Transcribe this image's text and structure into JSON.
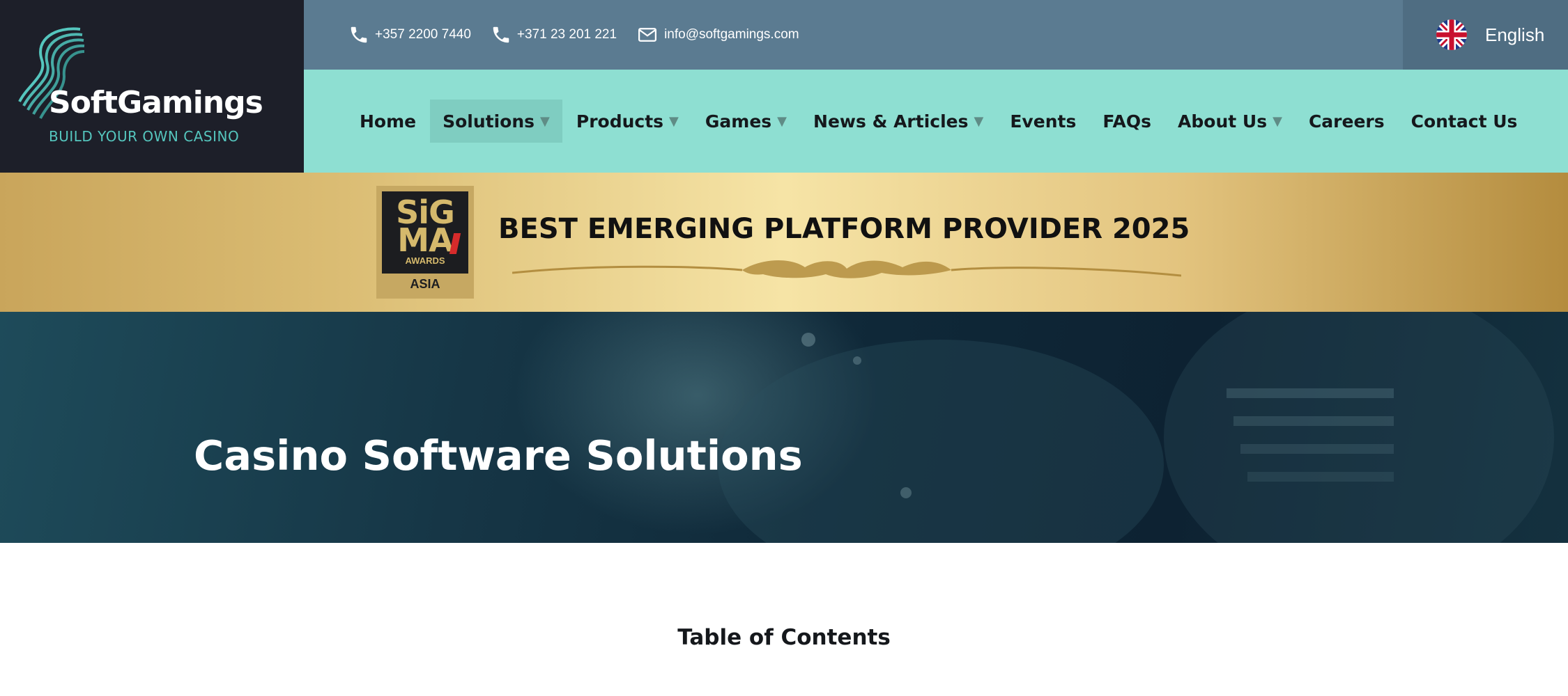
{
  "brand": {
    "name": "SoftGamings",
    "tagline": "BUILD YOUR OWN CASINO"
  },
  "contacts": [
    {
      "icon": "phone-icon",
      "text": "+357 2200 7440"
    },
    {
      "icon": "phone-icon",
      "text": "+371 23 201 221"
    },
    {
      "icon": "envelope-icon",
      "text": "info@softgamings.com"
    }
  ],
  "language": {
    "label": "English",
    "icon": "uk-flag-icon"
  },
  "nav": {
    "items": [
      {
        "label": "Home",
        "has_dropdown": false
      },
      {
        "label": "Solutions",
        "has_dropdown": true,
        "active": true
      },
      {
        "label": "Products",
        "has_dropdown": true
      },
      {
        "label": "Games",
        "has_dropdown": true
      },
      {
        "label": "News & Articles",
        "has_dropdown": true
      },
      {
        "label": "Events",
        "has_dropdown": false
      },
      {
        "label": "FAQs",
        "has_dropdown": false
      },
      {
        "label": "About Us",
        "has_dropdown": true
      },
      {
        "label": "Careers",
        "has_dropdown": false
      },
      {
        "label": "Contact Us",
        "has_dropdown": false
      }
    ],
    "caret": "▼"
  },
  "award": {
    "badge_line1": "SiG",
    "badge_line2": "MA",
    "badge_sub": "AWARDS",
    "badge_region": "ASIA",
    "title": "BEST EMERGING PLATFORM PROVIDER 2025"
  },
  "hero": {
    "title": "Casino Software Solutions"
  },
  "toc": {
    "title": "Table of Contents"
  },
  "colors": {
    "logo_bg": "#1d1f29",
    "accent_teal": "#55c6be",
    "contact_bar": "#5b7b91",
    "nav_bg": "#8edfd2",
    "nav_active": "#7fcdc1",
    "gold": "#e3c47f",
    "hero_dark": "#0f2838"
  }
}
